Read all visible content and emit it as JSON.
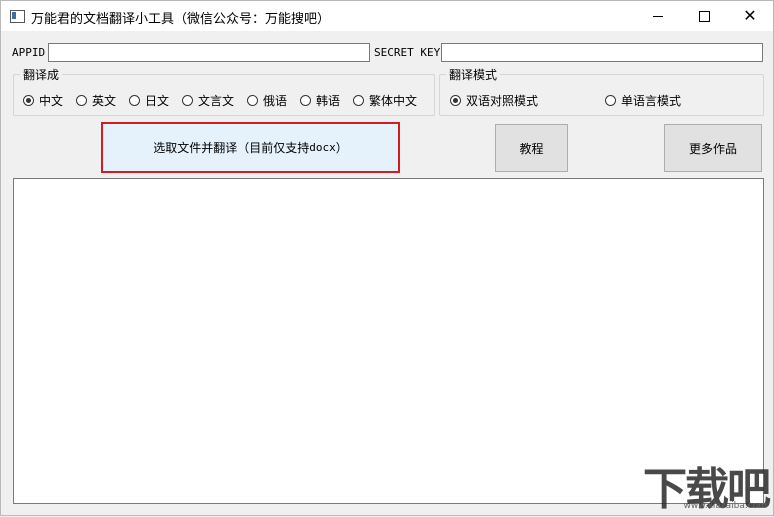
{
  "window": {
    "title": "万能君的文档翻译小工具（微信公众号：万能搜吧）",
    "controls": {
      "minimize": "—",
      "maximize": "☐",
      "close": "✕"
    }
  },
  "credentials": {
    "appid_label": "APPID",
    "appid_value": "",
    "secret_label": "SECRET KEY",
    "secret_value": ""
  },
  "translate_to": {
    "legend": "翻译成",
    "options": [
      {
        "label": "中文",
        "checked": true
      },
      {
        "label": "英文",
        "checked": false
      },
      {
        "label": "日文",
        "checked": false
      },
      {
        "label": "文言文",
        "checked": false
      },
      {
        "label": "俄语",
        "checked": false
      },
      {
        "label": "韩语",
        "checked": false
      },
      {
        "label": "繁体中文",
        "checked": false
      }
    ]
  },
  "mode": {
    "legend": "翻译模式",
    "options": [
      {
        "label": "双语对照模式",
        "checked": true
      },
      {
        "label": "单语言模式",
        "checked": false
      }
    ]
  },
  "buttons": {
    "select_file_prefix": "选取文件并翻译（目前仅支持",
    "select_file_ext": "docx",
    "select_file_suffix": "）",
    "tutorial": "教程",
    "more_works": "更多作品"
  },
  "output": {
    "text": ""
  },
  "watermark": {
    "text": "下载吧",
    "url": "www.xiazaiba.com"
  },
  "colors": {
    "highlight_border": "#d11d1d",
    "primary_button_bg": "#e5f1fb"
  }
}
